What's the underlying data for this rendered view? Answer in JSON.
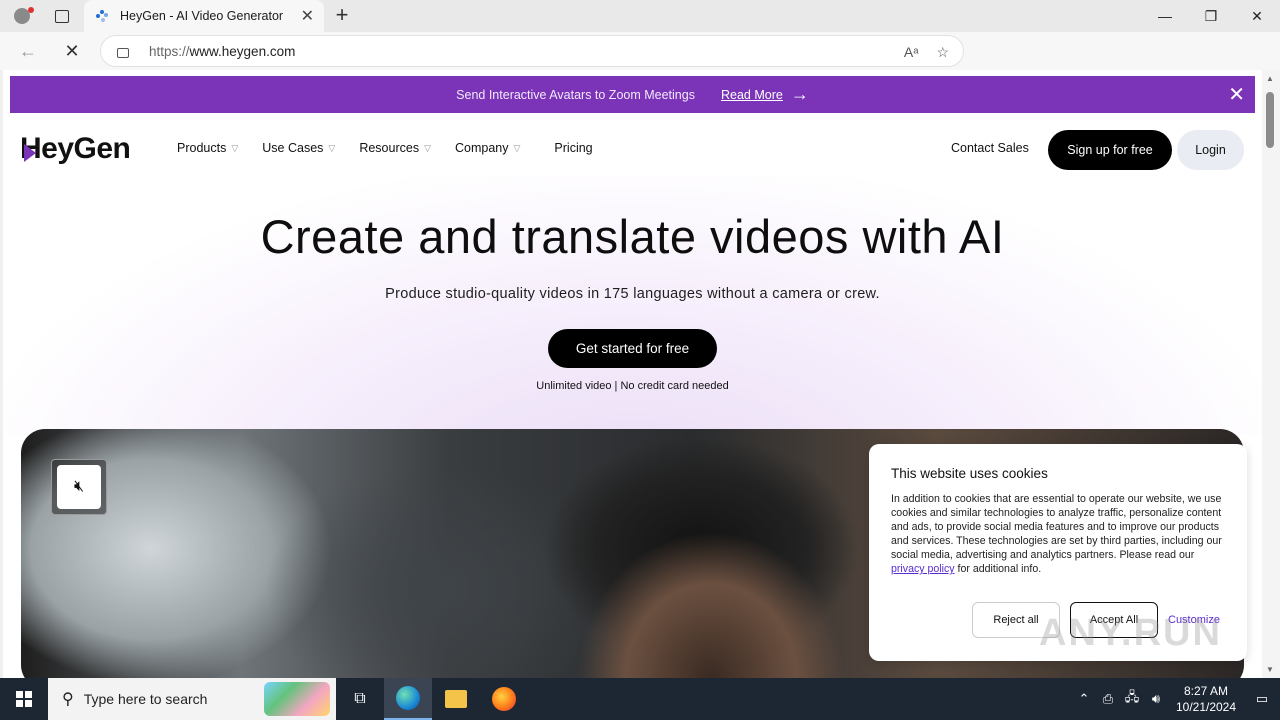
{
  "browser": {
    "tab_title": "HeyGen - AI Video Generator",
    "url_prefix": "https://",
    "url_domain": "www.heygen.com",
    "new_tab": "+",
    "tab_close": "✕"
  },
  "banner": {
    "message": "Send Interactive Avatars to Zoom Meetings",
    "link": "Read More"
  },
  "nav": {
    "logo": "HeyGen",
    "menu": [
      "Products",
      "Use Cases",
      "Resources",
      "Company",
      "Pricing"
    ],
    "contact": "Contact Sales",
    "signup": "Sign up for free",
    "login": "Login"
  },
  "hero": {
    "headline": "Create and translate videos with AI",
    "subline": "Produce studio-quality videos in 175 languages without a camera or crew.",
    "cta": "Get started for free",
    "note": "Unlimited video | No credit card needed"
  },
  "cookie": {
    "title": "This website uses cookies",
    "body": "In addition to cookies that are essential to operate our website, we use cookies and similar technologies to analyze traffic, personalize content and ads, to provide social media features and to improve our products and services. These technologies are set by third parties, including our social media, advertising and analytics partners. Please read our ",
    "link": "privacy policy",
    "body_end": " for additional info.",
    "reject": "Reject all",
    "accept": "Accept All",
    "customize": "Customize"
  },
  "watermark": "ANY.RUN",
  "taskbar": {
    "search_placeholder": "Type here to search",
    "time": "8:27 AM",
    "date": "10/21/2024"
  },
  "colors": {
    "brand_purple": "#7b34b8",
    "link_purple": "#5a2bd2",
    "taskbar": "#1d2633"
  }
}
